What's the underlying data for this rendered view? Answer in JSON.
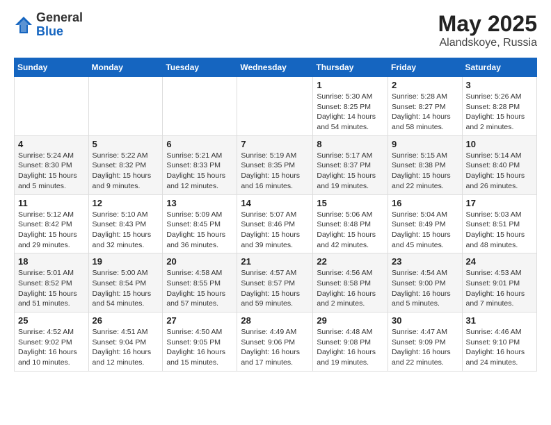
{
  "header": {
    "logo_line1": "General",
    "logo_line2": "Blue",
    "month_year": "May 2025",
    "location": "Alandskoye, Russia"
  },
  "days_of_week": [
    "Sunday",
    "Monday",
    "Tuesday",
    "Wednesday",
    "Thursday",
    "Friday",
    "Saturday"
  ],
  "weeks": [
    [
      {
        "day": "",
        "info": ""
      },
      {
        "day": "",
        "info": ""
      },
      {
        "day": "",
        "info": ""
      },
      {
        "day": "",
        "info": ""
      },
      {
        "day": "1",
        "info": "Sunrise: 5:30 AM\nSunset: 8:25 PM\nDaylight: 14 hours\nand 54 minutes."
      },
      {
        "day": "2",
        "info": "Sunrise: 5:28 AM\nSunset: 8:27 PM\nDaylight: 14 hours\nand 58 minutes."
      },
      {
        "day": "3",
        "info": "Sunrise: 5:26 AM\nSunset: 8:28 PM\nDaylight: 15 hours\nand 2 minutes."
      }
    ],
    [
      {
        "day": "4",
        "info": "Sunrise: 5:24 AM\nSunset: 8:30 PM\nDaylight: 15 hours\nand 5 minutes."
      },
      {
        "day": "5",
        "info": "Sunrise: 5:22 AM\nSunset: 8:32 PM\nDaylight: 15 hours\nand 9 minutes."
      },
      {
        "day": "6",
        "info": "Sunrise: 5:21 AM\nSunset: 8:33 PM\nDaylight: 15 hours\nand 12 minutes."
      },
      {
        "day": "7",
        "info": "Sunrise: 5:19 AM\nSunset: 8:35 PM\nDaylight: 15 hours\nand 16 minutes."
      },
      {
        "day": "8",
        "info": "Sunrise: 5:17 AM\nSunset: 8:37 PM\nDaylight: 15 hours\nand 19 minutes."
      },
      {
        "day": "9",
        "info": "Sunrise: 5:15 AM\nSunset: 8:38 PM\nDaylight: 15 hours\nand 22 minutes."
      },
      {
        "day": "10",
        "info": "Sunrise: 5:14 AM\nSunset: 8:40 PM\nDaylight: 15 hours\nand 26 minutes."
      }
    ],
    [
      {
        "day": "11",
        "info": "Sunrise: 5:12 AM\nSunset: 8:42 PM\nDaylight: 15 hours\nand 29 minutes."
      },
      {
        "day": "12",
        "info": "Sunrise: 5:10 AM\nSunset: 8:43 PM\nDaylight: 15 hours\nand 32 minutes."
      },
      {
        "day": "13",
        "info": "Sunrise: 5:09 AM\nSunset: 8:45 PM\nDaylight: 15 hours\nand 36 minutes."
      },
      {
        "day": "14",
        "info": "Sunrise: 5:07 AM\nSunset: 8:46 PM\nDaylight: 15 hours\nand 39 minutes."
      },
      {
        "day": "15",
        "info": "Sunrise: 5:06 AM\nSunset: 8:48 PM\nDaylight: 15 hours\nand 42 minutes."
      },
      {
        "day": "16",
        "info": "Sunrise: 5:04 AM\nSunset: 8:49 PM\nDaylight: 15 hours\nand 45 minutes."
      },
      {
        "day": "17",
        "info": "Sunrise: 5:03 AM\nSunset: 8:51 PM\nDaylight: 15 hours\nand 48 minutes."
      }
    ],
    [
      {
        "day": "18",
        "info": "Sunrise: 5:01 AM\nSunset: 8:52 PM\nDaylight: 15 hours\nand 51 minutes."
      },
      {
        "day": "19",
        "info": "Sunrise: 5:00 AM\nSunset: 8:54 PM\nDaylight: 15 hours\nand 54 minutes."
      },
      {
        "day": "20",
        "info": "Sunrise: 4:58 AM\nSunset: 8:55 PM\nDaylight: 15 hours\nand 57 minutes."
      },
      {
        "day": "21",
        "info": "Sunrise: 4:57 AM\nSunset: 8:57 PM\nDaylight: 15 hours\nand 59 minutes."
      },
      {
        "day": "22",
        "info": "Sunrise: 4:56 AM\nSunset: 8:58 PM\nDaylight: 16 hours\nand 2 minutes."
      },
      {
        "day": "23",
        "info": "Sunrise: 4:54 AM\nSunset: 9:00 PM\nDaylight: 16 hours\nand 5 minutes."
      },
      {
        "day": "24",
        "info": "Sunrise: 4:53 AM\nSunset: 9:01 PM\nDaylight: 16 hours\nand 7 minutes."
      }
    ],
    [
      {
        "day": "25",
        "info": "Sunrise: 4:52 AM\nSunset: 9:02 PM\nDaylight: 16 hours\nand 10 minutes."
      },
      {
        "day": "26",
        "info": "Sunrise: 4:51 AM\nSunset: 9:04 PM\nDaylight: 16 hours\nand 12 minutes."
      },
      {
        "day": "27",
        "info": "Sunrise: 4:50 AM\nSunset: 9:05 PM\nDaylight: 16 hours\nand 15 minutes."
      },
      {
        "day": "28",
        "info": "Sunrise: 4:49 AM\nSunset: 9:06 PM\nDaylight: 16 hours\nand 17 minutes."
      },
      {
        "day": "29",
        "info": "Sunrise: 4:48 AM\nSunset: 9:08 PM\nDaylight: 16 hours\nand 19 minutes."
      },
      {
        "day": "30",
        "info": "Sunrise: 4:47 AM\nSunset: 9:09 PM\nDaylight: 16 hours\nand 22 minutes."
      },
      {
        "day": "31",
        "info": "Sunrise: 4:46 AM\nSunset: 9:10 PM\nDaylight: 16 hours\nand 24 minutes."
      }
    ]
  ]
}
